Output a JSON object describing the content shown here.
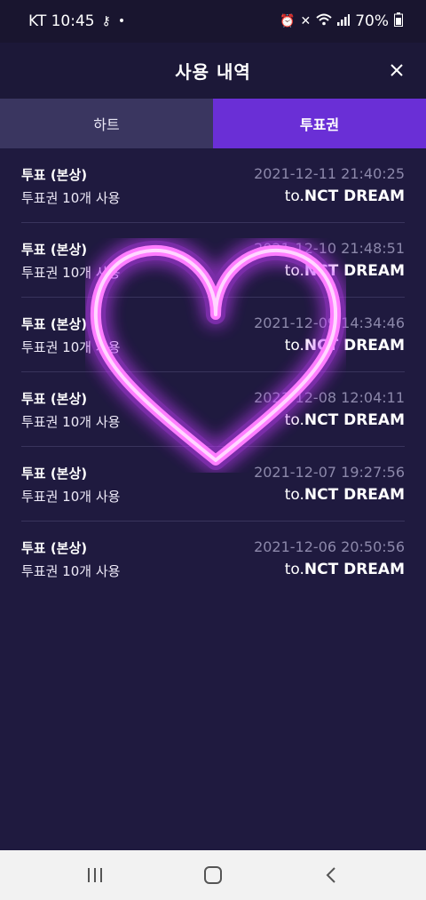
{
  "status": {
    "carrier_time": "KT 10:45",
    "battery": "70%"
  },
  "header": {
    "title": "사용 내역"
  },
  "tabs": [
    {
      "label": "하트"
    },
    {
      "label": "투표권"
    }
  ],
  "items": [
    {
      "type": "투표 (본상)",
      "desc": "투표권 10개 사용",
      "date": "2021-12-11 21:40:25",
      "to": "to.",
      "name": "NCT DREAM"
    },
    {
      "type": "투표 (본상)",
      "desc": "투표권 10개 사용",
      "date": "2021-12-10 21:48:51",
      "to": "to.",
      "name": "NCT DREAM"
    },
    {
      "type": "투표 (본상)",
      "desc": "투표권 10개 사용",
      "date": "2021-12-09 14:34:46",
      "to": "to.",
      "name": "NCT DREAM"
    },
    {
      "type": "투표 (본상)",
      "desc": "투표권 10개 사용",
      "date": "2021-12-08 12:04:11",
      "to": "to.",
      "name": "NCT DREAM"
    },
    {
      "type": "투표 (본상)",
      "desc": "투표권 10개 사용",
      "date": "2021-12-07 19:27:56",
      "to": "to.",
      "name": "NCT DREAM"
    },
    {
      "type": "투표 (본상)",
      "desc": "투표권 10개 사용",
      "date": "2021-12-06 20:50:56",
      "to": "to.",
      "name": "NCT DREAM"
    }
  ],
  "colors": {
    "accent": "#6a2fd6",
    "background": "#1f1a3f",
    "heart_glow": "#ff7dff"
  },
  "icons": [
    "key-icon",
    "alarm-icon",
    "mute-icon",
    "wifi-icon",
    "signal-icon",
    "battery-icon",
    "close-icon",
    "recent-apps-icon",
    "home-icon",
    "back-icon",
    "neon-heart-icon"
  ]
}
